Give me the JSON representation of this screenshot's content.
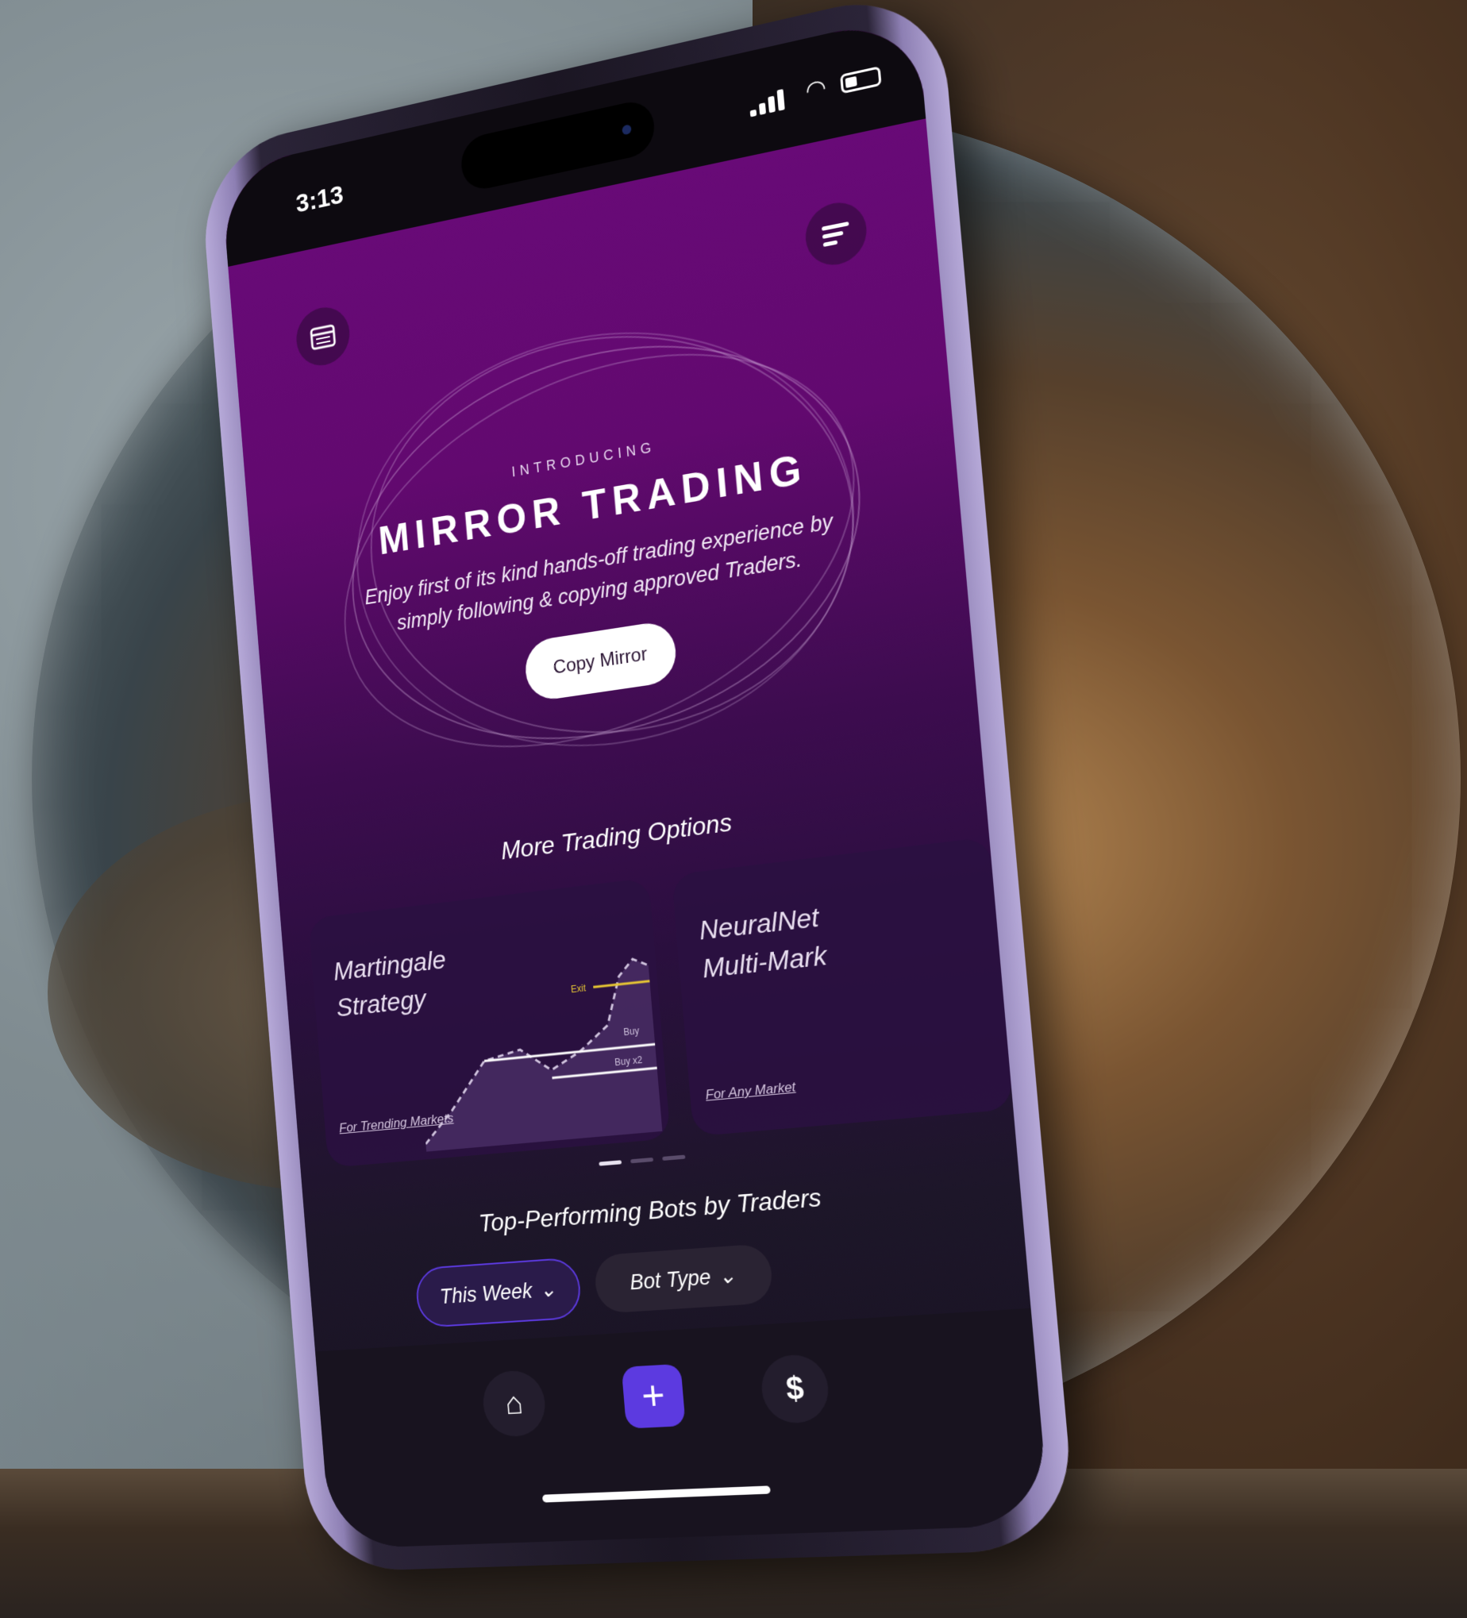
{
  "status_bar": {
    "time": "3:13"
  },
  "hero": {
    "eyebrow": "INTRODUCING",
    "title": "MIRROR TRADING",
    "description": "Enjoy first of its kind hands-off trading experience by simply following & copying approved Traders.",
    "cta_label": "Copy Mirror"
  },
  "options": {
    "section_title": "More Trading Options",
    "cards": [
      {
        "title_line1": "Martingale",
        "title_line2": "Strategy",
        "subtitle": "For Trending Markets",
        "chart_labels": {
          "exit": "Exit",
          "buy": "Buy",
          "buy_x2": "Buy x2"
        }
      },
      {
        "title_line1": "NeuralNet",
        "title_line2": "Multi-Mark",
        "subtitle": "For Any Market"
      }
    ],
    "pager": {
      "count": 3,
      "active_index": 0
    }
  },
  "bots": {
    "section_title": "Top-Performing Bots by Traders",
    "filters": [
      {
        "label": "This Week",
        "icon": "chevron-down-icon",
        "selected": true
      },
      {
        "label": "Bot Type",
        "icon": "chevron-down-icon",
        "selected": false
      }
    ]
  },
  "tabbar": {
    "items": [
      {
        "icon": "home-icon",
        "glyph": "⌂"
      },
      {
        "icon": "plus-icon",
        "glyph": "+"
      },
      {
        "icon": "dollar-icon",
        "glyph": "$"
      }
    ]
  },
  "colors": {
    "accent": "#5c3ae0",
    "screen_top": "#6a0a7a",
    "exit_line": "#e8c733"
  }
}
